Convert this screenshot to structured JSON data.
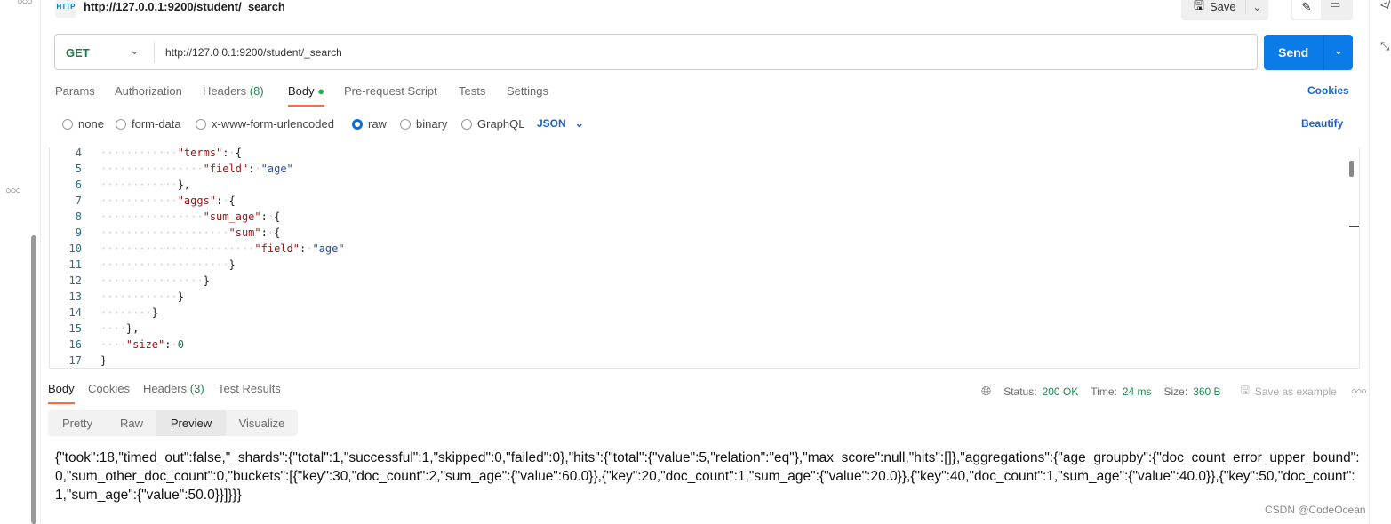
{
  "request": {
    "icon": "HTTP",
    "title": "http://127.0.0.1:9200/student/_search",
    "method": "GET",
    "url": "http://127.0.0.1:9200/student/_search",
    "save_label": "Save",
    "send_label": "Send"
  },
  "tabs": [
    {
      "label": "Params"
    },
    {
      "label": "Authorization"
    },
    {
      "label": "Headers",
      "count": "(8)"
    },
    {
      "label": "Body"
    },
    {
      "label": "Pre-request Script"
    },
    {
      "label": "Tests"
    },
    {
      "label": "Settings"
    }
  ],
  "cookies_label": "Cookies",
  "body_types": [
    {
      "label": "none"
    },
    {
      "label": "form-data"
    },
    {
      "label": "x-www-form-urlencoded"
    },
    {
      "label": "raw",
      "selected": true
    },
    {
      "label": "binary"
    },
    {
      "label": "GraphQL"
    }
  ],
  "format": "JSON",
  "beautify_label": "Beautify",
  "code_lines": [
    {
      "num": "4",
      "text": "            \"terms\": {"
    },
    {
      "num": "5",
      "text": "                \"field\": \"age\""
    },
    {
      "num": "6",
      "text": "            },"
    },
    {
      "num": "7",
      "text": "            \"aggs\": {"
    },
    {
      "num": "8",
      "text": "                \"sum_age\": {"
    },
    {
      "num": "9",
      "text": "                    \"sum\": {"
    },
    {
      "num": "10",
      "text": "                        \"field\": \"age\""
    },
    {
      "num": "11",
      "text": "                    }"
    },
    {
      "num": "12",
      "text": "                }"
    },
    {
      "num": "13",
      "text": "            }"
    },
    {
      "num": "14",
      "text": "        }"
    },
    {
      "num": "15",
      "text": "    },"
    },
    {
      "num": "16",
      "text": "    \"size\": 0"
    },
    {
      "num": "17",
      "text": "}"
    }
  ],
  "response": {
    "tabs": [
      {
        "label": "Body"
      },
      {
        "label": "Cookies"
      },
      {
        "label": "Headers",
        "count": "(3)"
      },
      {
        "label": "Test Results"
      }
    ],
    "status_label": "Status:",
    "status": "200 OK",
    "time_label": "Time:",
    "time": "24 ms",
    "size_label": "Size:",
    "size": "360 B",
    "save_example": "Save as example",
    "views": [
      "Pretty",
      "Raw",
      "Preview",
      "Visualize"
    ],
    "active_view": "Preview",
    "body": "{\"took\":18,\"timed_out\":false,\"_shards\":{\"total\":1,\"successful\":1,\"skipped\":0,\"failed\":0},\"hits\":{\"total\":{\"value\":5,\"relation\":\"eq\"},\"max_score\":null,\"hits\":[]},\"aggregations\":{\"age_groupby\":{\"doc_count_error_upper_bound\":0,\"sum_other_doc_count\":0,\"buckets\":[{\"key\":30,\"doc_count\":2,\"sum_age\":{\"value\":60.0}},{\"key\":20,\"doc_count\":1,\"sum_age\":{\"value\":20.0}},{\"key\":40,\"doc_count\":1,\"sum_age\":{\"value\":40.0}},{\"key\":50,\"doc_count\":1,\"sum_age\":{\"value\":50.0}}]}}}"
  },
  "watermark": "CSDN @CodeOcean",
  "colors": {
    "accent": "#0b7bea",
    "tab_underline": "#ff6c37",
    "ok": "#1f8a55",
    "body_dot": "#1bb34a"
  }
}
